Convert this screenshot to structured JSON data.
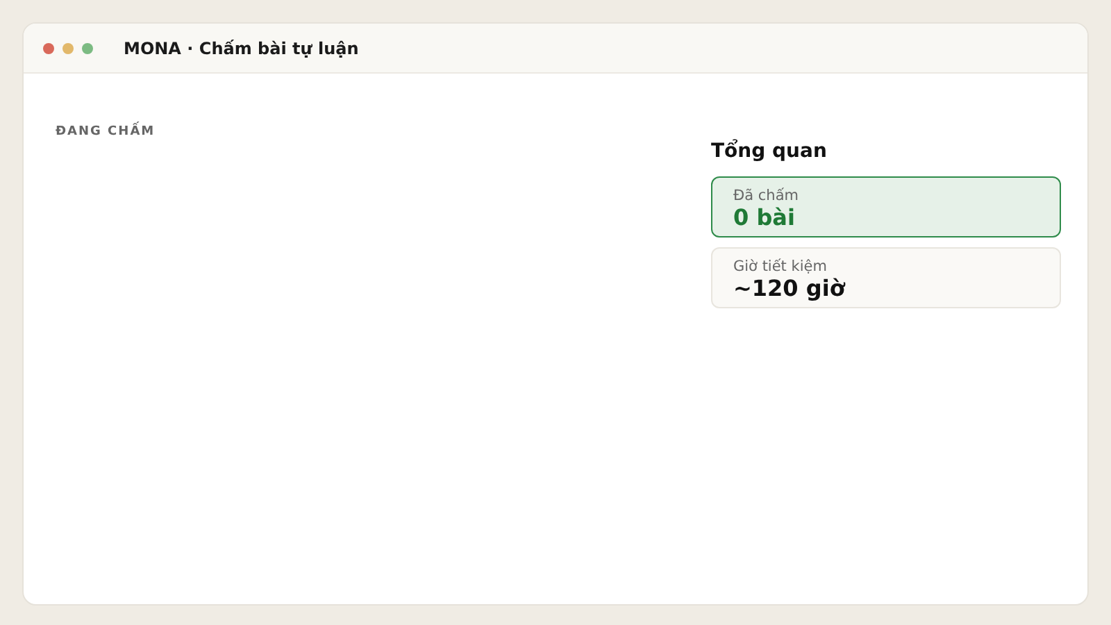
{
  "window": {
    "title": "MONA · Chấm bài tự luận"
  },
  "section_label": "ĐANG CHẤM",
  "overview": {
    "title": "Tổng quan",
    "stats": [
      {
        "label": "Đã chấm",
        "value": "0 bài",
        "highlighted": true
      },
      {
        "label": "Giờ tiết kiệm",
        "value": "~120 giờ",
        "highlighted": false
      }
    ]
  }
}
